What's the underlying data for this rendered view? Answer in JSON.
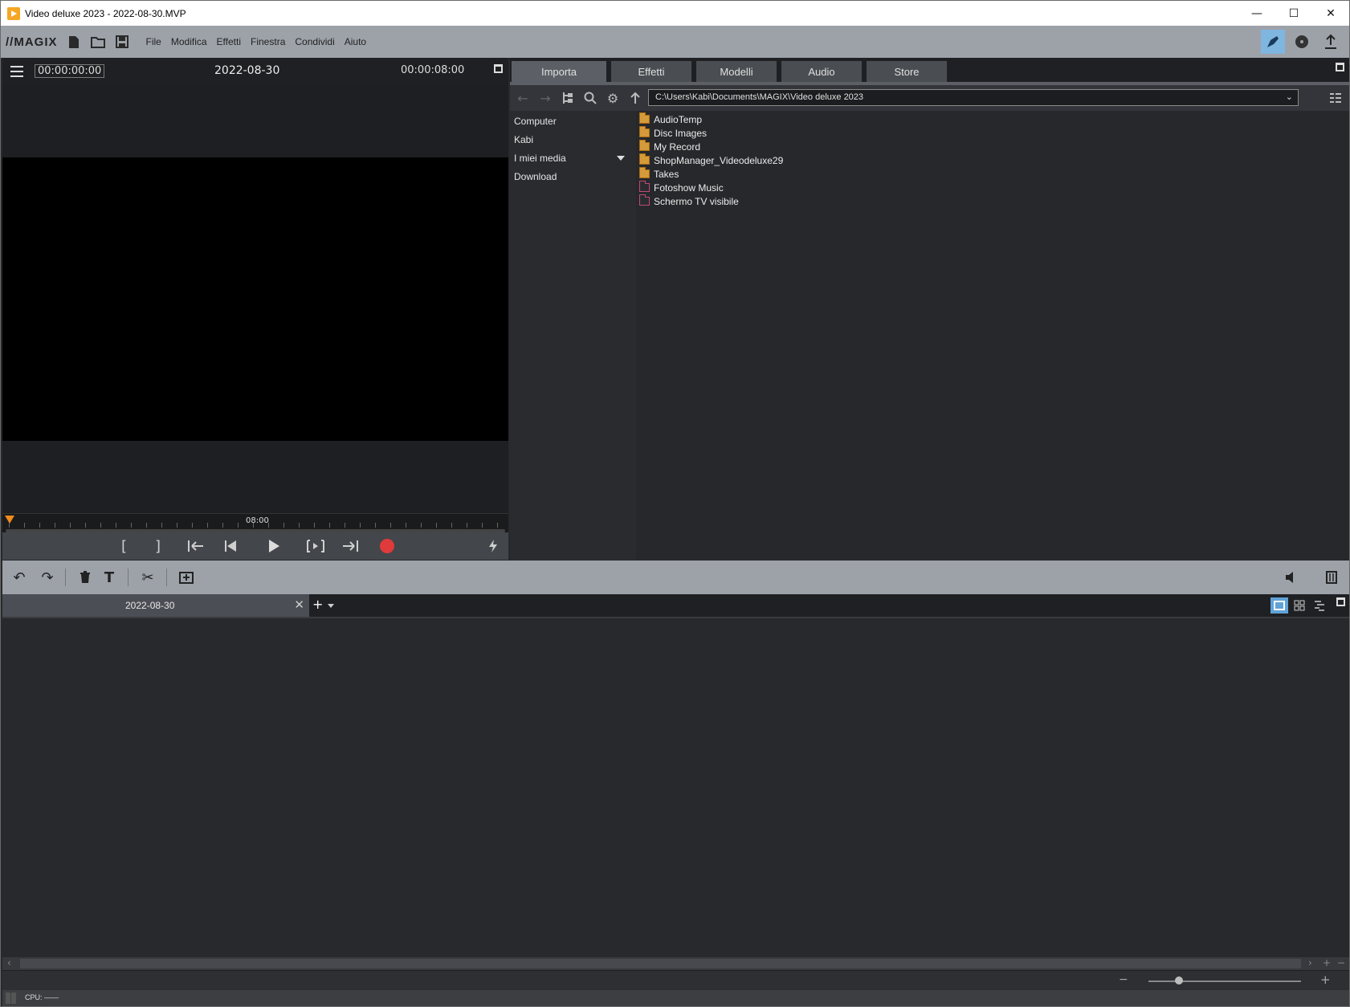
{
  "window": {
    "title": "Video deluxe 2023 - 2022-08-30.MVP",
    "minimize": "—",
    "maximize": "☐",
    "close": "✕"
  },
  "menubar": {
    "logo": "//MAGIX",
    "items": [
      "File",
      "Modifica",
      "Effetti",
      "Finestra",
      "Condividi",
      "Aiuto"
    ]
  },
  "preview": {
    "timecode_current": "00:00:00:00",
    "title": "2022-08-30",
    "timecode_total": "00:00:08:00",
    "ruler_label": "08:00"
  },
  "media": {
    "tabs": [
      "Importa",
      "Effetti",
      "Modelli",
      "Audio",
      "Store"
    ],
    "active_tab": "Importa",
    "path": "C:\\Users\\Kabi\\Documents\\MAGIX\\Video deluxe 2023",
    "nav": [
      "Computer",
      "Kabi",
      "I miei media",
      "Download"
    ],
    "files": [
      {
        "name": "AudioTemp",
        "kind": "folder"
      },
      {
        "name": "Disc Images",
        "kind": "folder"
      },
      {
        "name": "My Record",
        "kind": "folder"
      },
      {
        "name": "ShopManager_Videodeluxe29",
        "kind": "folder"
      },
      {
        "name": "Takes",
        "kind": "folder"
      },
      {
        "name": "Fotoshow Music",
        "kind": "special-folder"
      },
      {
        "name": "Schermo TV visibile",
        "kind": "special-folder"
      }
    ]
  },
  "project": {
    "tab_label": "2022-08-30",
    "close": "✕",
    "add": "+"
  },
  "status": {
    "cpu": "CPU: ——"
  },
  "colors": {
    "accent_blue": "#7fb6e0",
    "record_red": "#e03a3a",
    "playhead_orange": "#f08a1c",
    "folder_orange": "#d59a3a",
    "special_folder_pink": "#c04a70"
  }
}
